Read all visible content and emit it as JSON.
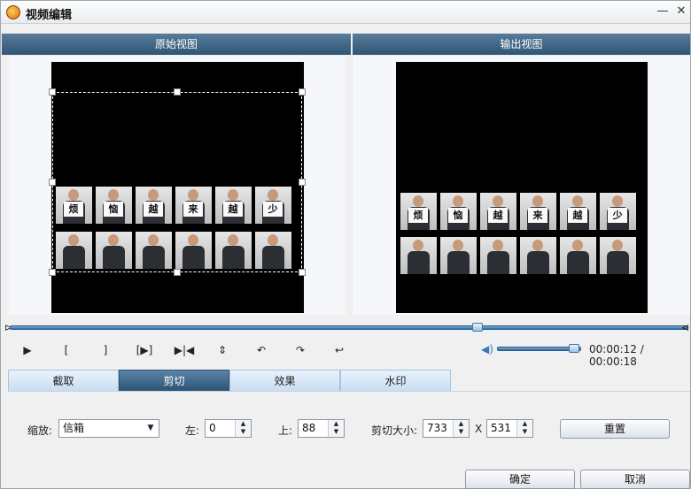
{
  "window": {
    "title": "视频编辑",
    "minimize": "—",
    "close": "✕"
  },
  "views": {
    "original": "原始视图",
    "output": "输出视图"
  },
  "thumbnails": {
    "cards": [
      "烦",
      "恼",
      "越",
      "来",
      "越",
      "少"
    ]
  },
  "player": {
    "seek_start": "⊳",
    "seek_end": "⊲",
    "controls": {
      "play": "▶",
      "mark_in": "[",
      "mark_out": "]",
      "play_selection": "[▶]",
      "next_frame": "▶|◀",
      "flip_vertical": "⇕",
      "rotate_left": "↶",
      "rotate_right": "↷",
      "undo": "↩"
    },
    "volume_icon": "speaker-icon",
    "time": "00:00:12 / 00:00:18",
    "progress": 0.69,
    "volume": 0.92
  },
  "tabs": [
    {
      "label": "截取",
      "active": false
    },
    {
      "label": "剪切",
      "active": true
    },
    {
      "label": "效果",
      "active": false
    },
    {
      "label": "水印",
      "active": false
    }
  ],
  "crop": {
    "zoom_label": "缩放:",
    "zoom_value": "信箱",
    "left_label": "左:",
    "left_value": "0",
    "top_label": "上:",
    "top_value": "88",
    "size_label": "剪切大小:",
    "width_value": "733",
    "x_label": "X",
    "height_value": "531",
    "reset": "重置"
  },
  "footer": {
    "ok": "确定",
    "cancel": "取消"
  },
  "colors": {
    "header": "#2f5676",
    "accent": "#2d6ca7",
    "active_tab": "#2e5475"
  }
}
